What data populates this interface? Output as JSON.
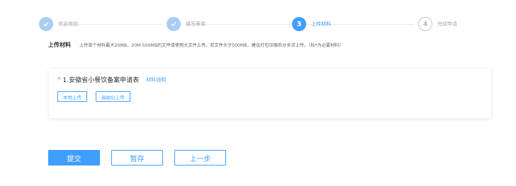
{
  "steps": [
    {
      "label": "信息核验",
      "status": "done",
      "number": "1"
    },
    {
      "label": "填写表单",
      "status": "done",
      "number": "2"
    },
    {
      "label": "上传材料",
      "status": "active",
      "number": "3"
    },
    {
      "label": "完成申请",
      "status": "todo",
      "number": "4"
    }
  ],
  "upload": {
    "title": "上传材料",
    "description": "上传单个材料最大20MB，20M-500MB的文件请使用大文件上传。若文件大于500MB，建议打包压缩后分多次上传。（标*为必要材料）"
  },
  "material": {
    "required_mark": "*",
    "name": "1.安徽省小餐饮备案申请表",
    "link": "材料说明",
    "local_upload": "本地上传",
    "camera_upload": "高拍仪上传"
  },
  "actions": {
    "submit": "提交",
    "save": "暂存",
    "prev": "上一步"
  },
  "icons": {
    "done": "check-icon"
  },
  "colors": {
    "primary": "#409eff",
    "done": "#a9cdf3",
    "required": "#f56c6c"
  }
}
